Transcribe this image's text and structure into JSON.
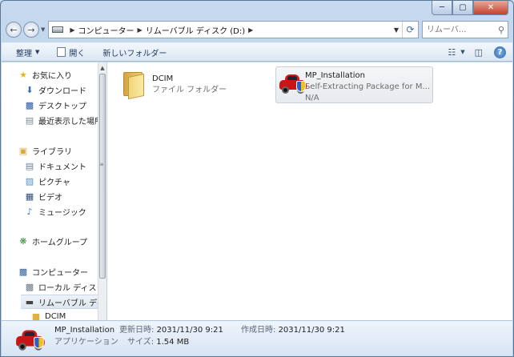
{
  "breadcrumb": [
    "コンピューター",
    "リムーバブル ディスク (D:)"
  ],
  "search": {
    "placeholder": "リムーバ..."
  },
  "toolbar": {
    "organize": "整理",
    "open": "開く",
    "new_folder": "新しいフォルダー"
  },
  "nav": {
    "favorites": "お気に入り",
    "downloads": "ダウンロード",
    "desktop": "デスクトップ",
    "recent": "最近表示した場所",
    "libraries": "ライブラリ",
    "documents": "ドキュメント",
    "pictures": "ピクチャ",
    "videos": "ビデオ",
    "music": "ミュージック",
    "homegroup": "ホームグループ",
    "computer": "コンピューター",
    "local_disk": "ローカル ディスク",
    "removable": "リムーバブル ディスク",
    "dcim": "DCIM"
  },
  "files": [
    {
      "name": "DCIM",
      "sub": "ファイル フォルダー",
      "icon": "folder-icon"
    },
    {
      "name": "MP_Installation",
      "sub": "Self-Extracting Package for M...",
      "sub2": "N/A",
      "icon": "car-installer-icon"
    }
  ],
  "details": {
    "name": "MP_Installation",
    "type": "アプリケーション",
    "modified_label": "更新日時:",
    "modified": "2031/11/30 9:21",
    "created_label": "作成日時:",
    "created": "2031/11/30 9:21",
    "size_label": "サイズ:",
    "size": "1.54 MB"
  }
}
